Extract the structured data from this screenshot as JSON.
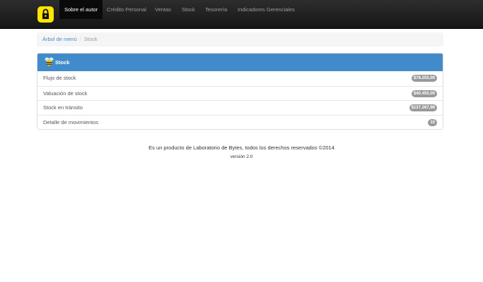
{
  "navbar": {
    "items": [
      {
        "label": "Sobre el autor",
        "active": true
      },
      {
        "label": "Crédito Personal",
        "active": false
      },
      {
        "label": "Ventas",
        "active": false
      },
      {
        "label": "Stock",
        "active": false
      },
      {
        "label": "Tesorería",
        "active": false
      },
      {
        "label": "Indicadores Gerenciales",
        "active": false
      }
    ]
  },
  "breadcrumb": {
    "root": "Árbol de menú",
    "separator": "/",
    "current": "Stock"
  },
  "panel": {
    "title": "Stock",
    "rows": [
      {
        "label": "Flujo de stock",
        "badge": "$78.255,00"
      },
      {
        "label": "Valuación de stock",
        "badge": "$40.455,00"
      },
      {
        "label": "Stock en tránsito",
        "badge": "$137.267,98"
      },
      {
        "label": "Detalle de movimientos",
        "badge": "10"
      }
    ]
  },
  "footer": {
    "text": "Es un producto de Laboratorio de Bytes, todos los derechos reservados ©2014",
    "version": "versión 2.0"
  },
  "colors": {
    "navbar": "#1b1b1b",
    "brand_logo": "#ffe600",
    "panel_heading": "#428bca",
    "badge": "#999999",
    "link": "#428bca"
  }
}
